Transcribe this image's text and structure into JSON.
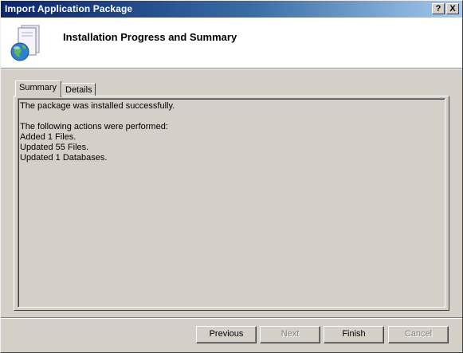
{
  "window": {
    "title": "Import Application Package",
    "help_button": "?",
    "close_button": "X"
  },
  "header": {
    "title": "Installation Progress and Summary",
    "icon": "package-globe-icon"
  },
  "tabs": [
    {
      "label": "Summary",
      "active": true
    },
    {
      "label": "Details",
      "active": false
    }
  ],
  "summary": {
    "lines": [
      "The package was installed successfully.",
      "",
      "The following actions were performed:",
      "Added 1 Files.",
      "Updated 55 Files.",
      "Updated 1 Databases."
    ]
  },
  "buttons": {
    "previous": "Previous",
    "next": "Next",
    "finish": "Finish",
    "cancel": "Cancel"
  }
}
